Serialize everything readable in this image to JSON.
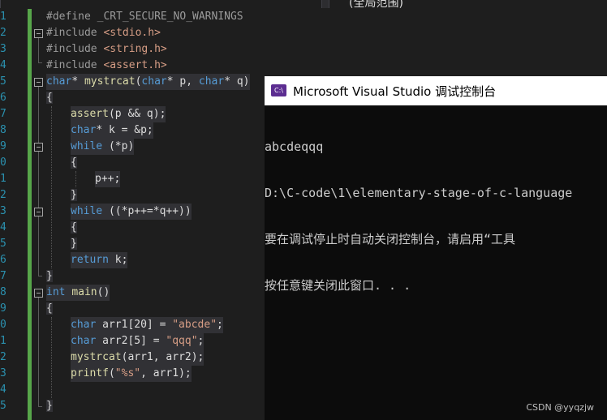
{
  "top": {
    "scope_label": "(全局范围)"
  },
  "editor": {
    "line_numbers": [
      "1",
      "2",
      "3",
      "4",
      "5",
      "6",
      "7",
      "8",
      "9",
      "0",
      "1",
      "2",
      "3",
      "4",
      "5",
      "6",
      "7",
      "8",
      "9",
      "0",
      "1",
      "2",
      "3",
      "4",
      "5"
    ],
    "lines": [
      [
        "#define",
        " _CRT_SECURE_NO_WARNINGS"
      ],
      [
        "#include",
        " ",
        "<stdio.h>"
      ],
      [
        "#include",
        " ",
        "<string.h>"
      ],
      [
        "#include",
        " ",
        "<assert.h>"
      ],
      [
        "char",
        "* ",
        "mystrcat",
        "(",
        "char",
        "* p, ",
        "char",
        "* q)"
      ],
      [
        "{"
      ],
      [
        "assert",
        "(p && q);"
      ],
      [
        "char",
        "* k = &p;"
      ],
      [
        "while",
        " (*p)"
      ],
      [
        "{"
      ],
      [
        "p++;"
      ],
      [
        "}"
      ],
      [
        "while",
        " ((*p++=*q++))"
      ],
      [
        "{"
      ],
      [
        "}"
      ],
      [
        "return",
        " k;"
      ],
      [
        "}"
      ],
      [
        "int",
        " ",
        "main",
        "()"
      ],
      [
        "{"
      ],
      [
        "char",
        " arr1[20] = ",
        "\"abcde\"",
        ";"
      ],
      [
        "char",
        " arr2[5] = ",
        "\"qqq\"",
        ";"
      ],
      [
        "mystrcat",
        "(arr1, arr2);"
      ],
      [
        "printf",
        "(",
        "\"%s\"",
        ", arr1);"
      ],
      [
        ""
      ],
      [
        "}"
      ]
    ]
  },
  "console": {
    "title": "Microsoft Visual Studio 调试控制台",
    "icon_label": "C:\\",
    "output_lines": [
      "abcdeqqq",
      "D:\\C-code\\1\\elementary-stage-of-c-language",
      "要在调试停止时自动关闭控制台，请启用“工具",
      "按任意键关闭此窗口. . ."
    ]
  },
  "watermark": "CSDN @yyqzjw"
}
